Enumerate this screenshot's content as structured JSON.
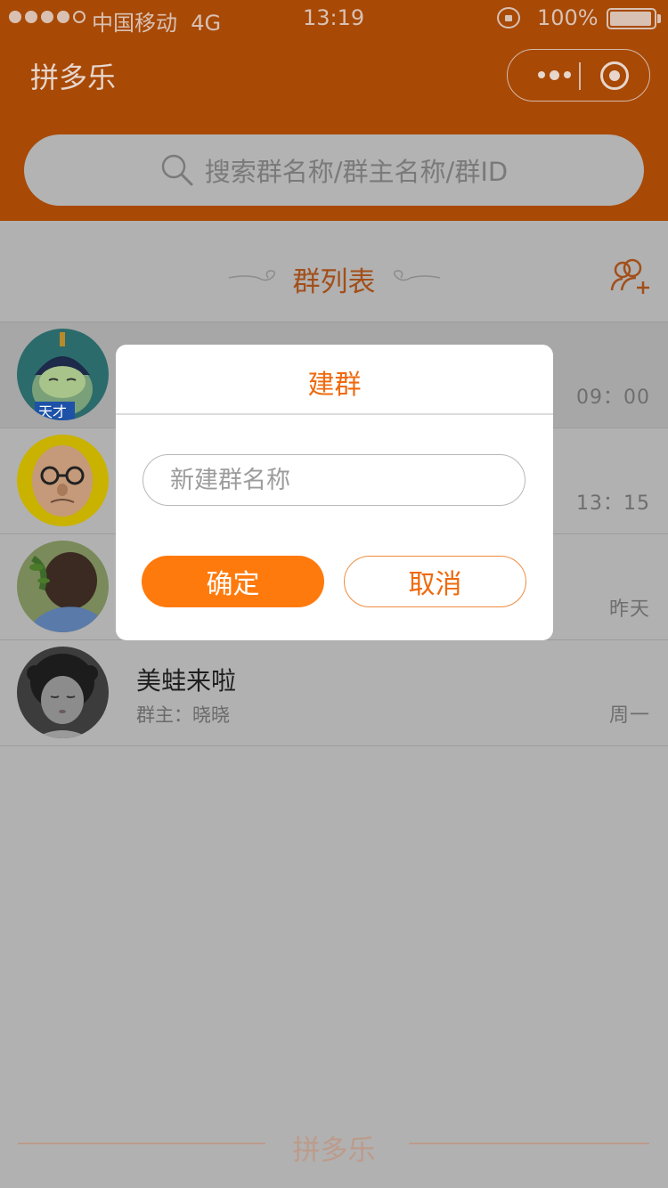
{
  "status_bar": {
    "carrier": "中国移动",
    "network": "4G",
    "time": "13:19",
    "battery": "100%"
  },
  "nav": {
    "title": "拼多乐"
  },
  "search": {
    "placeholder": "搜索群名称/群主名称/群ID"
  },
  "section": {
    "title": "群列表"
  },
  "groups": [
    {
      "name": "",
      "owner": "",
      "time": "09：00",
      "avatar": "cartoon-boy"
    },
    {
      "name": "",
      "owner": "",
      "time": "13：15",
      "avatar": "cartoon-old-man"
    },
    {
      "name": "",
      "owner": "",
      "time": "昨天",
      "avatar": "girl-back"
    },
    {
      "name": "美蛙来啦",
      "owner": "群主：晓晓",
      "time": "周一",
      "avatar": "little-girl"
    }
  ],
  "footer": {
    "text": "拼多乐"
  },
  "modal": {
    "title": "建群",
    "input_placeholder": "新建群名称",
    "confirm_label": "确定",
    "cancel_label": "取消"
  },
  "colors": {
    "brand": "#ff7a0c",
    "brand_dimmed": "#a84906",
    "overlay_bg": "#b1b1b1"
  }
}
